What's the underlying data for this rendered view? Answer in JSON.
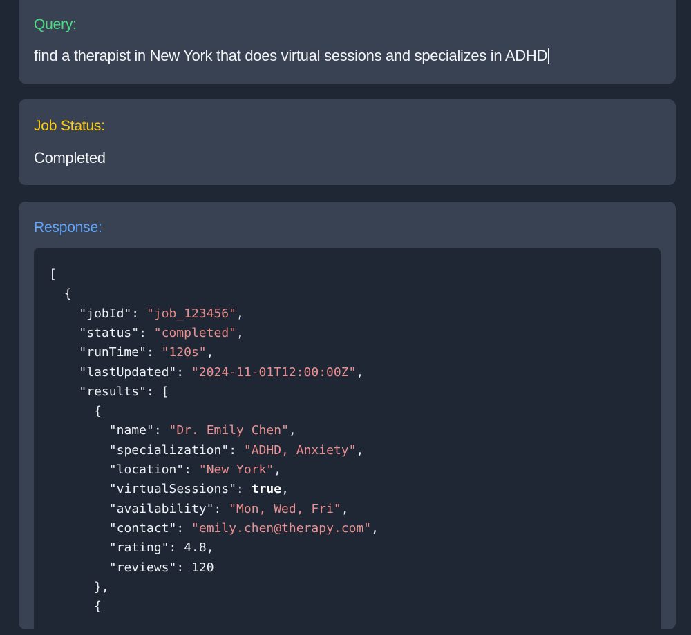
{
  "query": {
    "label": "Query:",
    "value": "find a therapist in New York that does virtual sessions and specializes in ADHD",
    "label_color": "#4ade80"
  },
  "job_status": {
    "label": "Job Status:",
    "value": "Completed",
    "label_color": "#facc15"
  },
  "response": {
    "label": "Response:",
    "label_color": "#60a5fa",
    "code_lines": [
      {
        "indent": 0,
        "parts": [
          {
            "t": "p",
            "v": "["
          }
        ]
      },
      {
        "indent": 1,
        "parts": [
          {
            "t": "p",
            "v": "{"
          }
        ]
      },
      {
        "indent": 2,
        "parts": [
          {
            "t": "k",
            "v": "\"jobId\""
          },
          {
            "t": "p",
            "v": ": "
          },
          {
            "t": "s",
            "v": "\"job_123456\""
          },
          {
            "t": "p",
            "v": ","
          }
        ]
      },
      {
        "indent": 2,
        "parts": [
          {
            "t": "k",
            "v": "\"status\""
          },
          {
            "t": "p",
            "v": ": "
          },
          {
            "t": "s",
            "v": "\"completed\""
          },
          {
            "t": "p",
            "v": ","
          }
        ]
      },
      {
        "indent": 2,
        "parts": [
          {
            "t": "k",
            "v": "\"runTime\""
          },
          {
            "t": "p",
            "v": ": "
          },
          {
            "t": "s",
            "v": "\"120s\""
          },
          {
            "t": "p",
            "v": ","
          }
        ]
      },
      {
        "indent": 2,
        "parts": [
          {
            "t": "k",
            "v": "\"lastUpdated\""
          },
          {
            "t": "p",
            "v": ": "
          },
          {
            "t": "s",
            "v": "\"2024-11-01T12:00:00Z\""
          },
          {
            "t": "p",
            "v": ","
          }
        ]
      },
      {
        "indent": 2,
        "parts": [
          {
            "t": "k",
            "v": "\"results\""
          },
          {
            "t": "p",
            "v": ": ["
          }
        ]
      },
      {
        "indent": 3,
        "parts": [
          {
            "t": "p",
            "v": "{"
          }
        ]
      },
      {
        "indent": 4,
        "parts": [
          {
            "t": "k",
            "v": "\"name\""
          },
          {
            "t": "p",
            "v": ": "
          },
          {
            "t": "s",
            "v": "\"Dr. Emily Chen\""
          },
          {
            "t": "p",
            "v": ","
          }
        ]
      },
      {
        "indent": 4,
        "parts": [
          {
            "t": "k",
            "v": "\"specialization\""
          },
          {
            "t": "p",
            "v": ": "
          },
          {
            "t": "s",
            "v": "\"ADHD, Anxiety\""
          },
          {
            "t": "p",
            "v": ","
          }
        ]
      },
      {
        "indent": 4,
        "parts": [
          {
            "t": "k",
            "v": "\"location\""
          },
          {
            "t": "p",
            "v": ": "
          },
          {
            "t": "s",
            "v": "\"New York\""
          },
          {
            "t": "p",
            "v": ","
          }
        ]
      },
      {
        "indent": 4,
        "parts": [
          {
            "t": "k",
            "v": "\"virtualSessions\""
          },
          {
            "t": "p",
            "v": ": "
          },
          {
            "t": "b",
            "v": "true"
          },
          {
            "t": "p",
            "v": ","
          }
        ]
      },
      {
        "indent": 4,
        "parts": [
          {
            "t": "k",
            "v": "\"availability\""
          },
          {
            "t": "p",
            "v": ": "
          },
          {
            "t": "s",
            "v": "\"Mon, Wed, Fri\""
          },
          {
            "t": "p",
            "v": ","
          }
        ]
      },
      {
        "indent": 4,
        "parts": [
          {
            "t": "k",
            "v": "\"contact\""
          },
          {
            "t": "p",
            "v": ": "
          },
          {
            "t": "s",
            "v": "\"emily.chen@therapy.com\""
          },
          {
            "t": "p",
            "v": ","
          }
        ]
      },
      {
        "indent": 4,
        "parts": [
          {
            "t": "k",
            "v": "\"rating\""
          },
          {
            "t": "p",
            "v": ": "
          },
          {
            "t": "n",
            "v": "4.8"
          },
          {
            "t": "p",
            "v": ","
          }
        ]
      },
      {
        "indent": 4,
        "parts": [
          {
            "t": "k",
            "v": "\"reviews\""
          },
          {
            "t": "p",
            "v": ": "
          },
          {
            "t": "n",
            "v": "120"
          }
        ]
      },
      {
        "indent": 3,
        "parts": [
          {
            "t": "p",
            "v": "},"
          }
        ]
      },
      {
        "indent": 3,
        "parts": [
          {
            "t": "p",
            "v": "{"
          }
        ]
      }
    ]
  }
}
